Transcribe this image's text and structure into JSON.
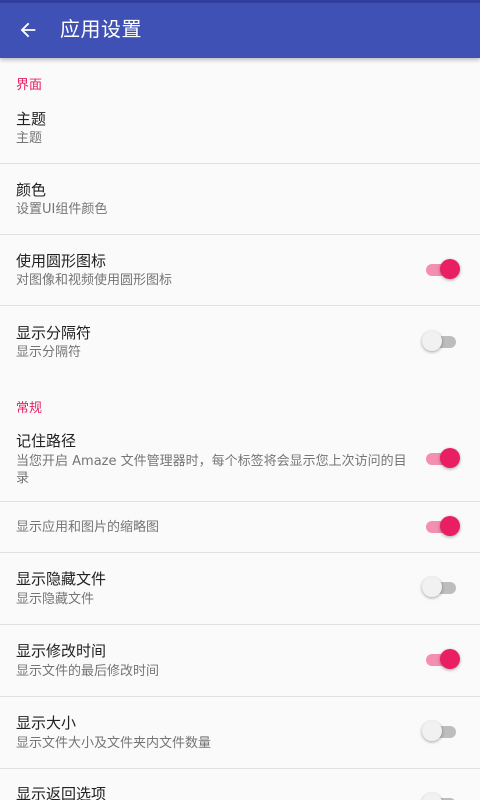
{
  "appbar": {
    "title": "应用设置",
    "back_icon": "arrow-left-icon",
    "color": "#3f51b5"
  },
  "accent_color": "#e91e63",
  "sections": {
    "interface": {
      "header": "界面"
    },
    "general": {
      "header": "常规"
    }
  },
  "items": {
    "theme": {
      "title": "主题",
      "summary": "主题"
    },
    "color": {
      "title": "颜色",
      "summary": "设置UI组件颜色"
    },
    "circular_icons": {
      "title": "使用圆形图标",
      "summary": "对图像和视频使用圆形图标",
      "checked": true
    },
    "show_dividers": {
      "title": "显示分隔符",
      "summary": "显示分隔符",
      "checked": false
    },
    "remember_path": {
      "title": "记住路径",
      "summary": "当您开启 Amaze 文件管理器时，每个标签将会显示您上次访问的目录",
      "checked": true
    },
    "show_thumbnails": {
      "summary": "显示应用和图片的缩略图",
      "checked": true
    },
    "show_hidden": {
      "title": "显示隐藏文件",
      "summary": "显示隐藏文件",
      "checked": false
    },
    "show_modified_time": {
      "title": "显示修改时间",
      "summary": "显示文件的最后修改时间",
      "checked": true
    },
    "show_size": {
      "title": "显示大小",
      "summary": "显示文件大小及文件夹内文件数量",
      "checked": false
    },
    "show_back_option": {
      "title": "显示返回选项",
      "checked": false
    }
  }
}
